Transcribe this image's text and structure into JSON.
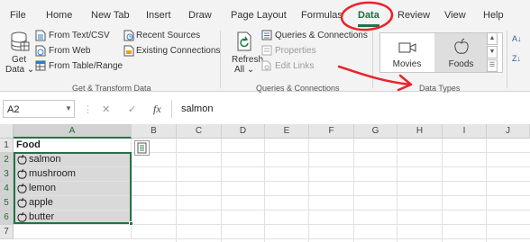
{
  "tabs": [
    {
      "id": "file",
      "label": "File"
    },
    {
      "id": "home",
      "label": "Home"
    },
    {
      "id": "newtab",
      "label": "New Tab"
    },
    {
      "id": "insert",
      "label": "Insert"
    },
    {
      "id": "draw",
      "label": "Draw"
    },
    {
      "id": "pagelayout",
      "label": "Page Layout"
    },
    {
      "id": "formulas",
      "label": "Formulas"
    },
    {
      "id": "data",
      "label": "Data",
      "active": true
    },
    {
      "id": "review",
      "label": "Review"
    },
    {
      "id": "view",
      "label": "View"
    },
    {
      "id": "help",
      "label": "Help"
    }
  ],
  "ribbon": {
    "get_transform": {
      "get_data_line1": "Get",
      "get_data_line2": "Data ⌄",
      "from_text_csv": "From Text/CSV",
      "from_web": "From Web",
      "from_table_range": "From Table/Range",
      "recent_sources": "Recent Sources",
      "existing_connections": "Existing Connections",
      "group_label": "Get & Transform Data"
    },
    "queries": {
      "refresh_line1": "Refresh",
      "refresh_line2": "All ⌄",
      "queries_connections": "Queries & Connections",
      "properties": "Properties",
      "edit_links": "Edit Links",
      "group_label": "Queries & Connections"
    },
    "data_types": {
      "movies": "Movies",
      "foods": "Foods",
      "group_label": "Data Types"
    }
  },
  "formula_bar": {
    "name_box": "A2",
    "fx": "fx",
    "content": "salmon"
  },
  "sheet": {
    "columns": [
      "A",
      "B",
      "C",
      "D",
      "E",
      "F",
      "G",
      "H",
      "I",
      "J"
    ],
    "rows": [
      "1",
      "2",
      "3",
      "4",
      "5",
      "6",
      "7"
    ],
    "header_cell": "Food",
    "foods": [
      "salmon",
      "mushroom",
      "lemon",
      "apple",
      "butter"
    ]
  },
  "colors": {
    "accent": "#217346",
    "annotation": "#e8232a",
    "selected_cells": "#d9d9d9"
  }
}
